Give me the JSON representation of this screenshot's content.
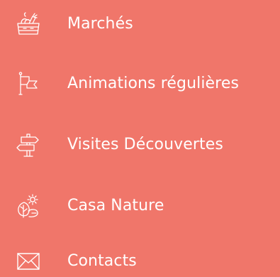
{
  "theme": {
    "background": "#f0766a",
    "foreground": "#ffffff"
  },
  "menu": {
    "items": [
      {
        "label": "Marchés",
        "icon": "market-crate-icon"
      },
      {
        "label": "Animations régulières",
        "icon": "flag-icon"
      },
      {
        "label": "Visites Découvertes",
        "icon": "signpost-icon"
      },
      {
        "label": "Casa Nature",
        "icon": "nature-plant-icon"
      },
      {
        "label": "Contacts",
        "icon": "envelope-icon"
      }
    ]
  }
}
